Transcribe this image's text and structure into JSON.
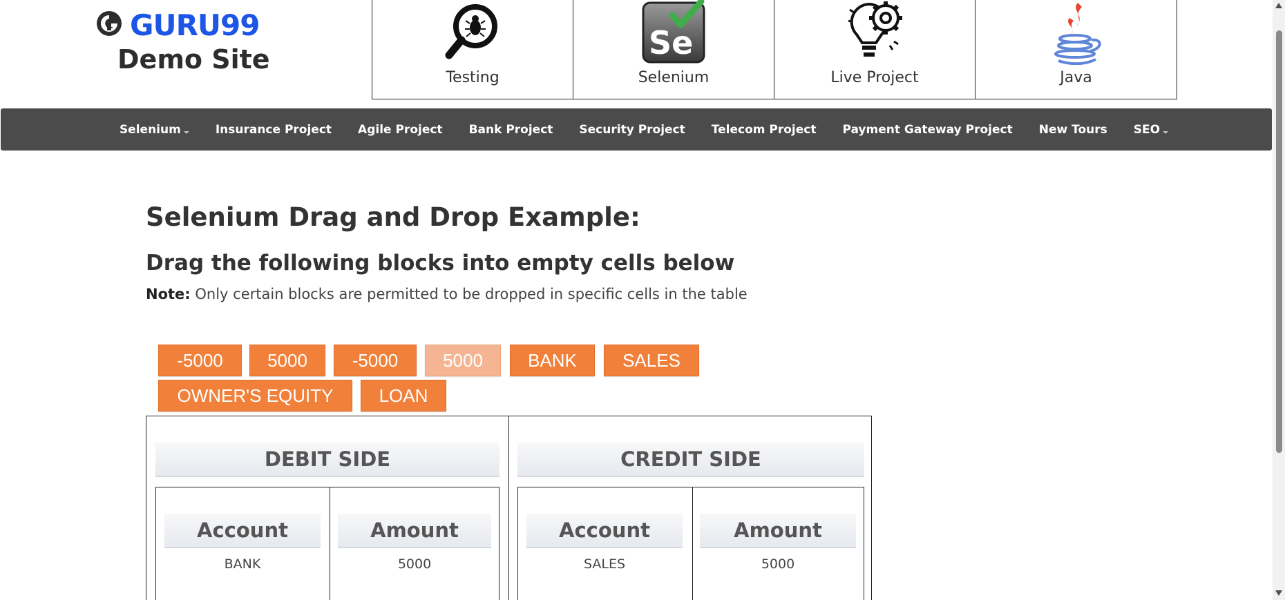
{
  "logo": {
    "brand": "GURU99",
    "subtitle": "Demo Site"
  },
  "top_boxes": [
    {
      "label": "Testing",
      "icon": "magnifier-bug-icon"
    },
    {
      "label": "Selenium",
      "icon": "selenium-logo-icon"
    },
    {
      "label": "Live Project",
      "icon": "lightbulb-gear-icon"
    },
    {
      "label": "Java",
      "icon": "java-logo-icon"
    }
  ],
  "nav": {
    "items": [
      {
        "label": "Selenium"
      },
      {
        "label": "Insurance Project"
      },
      {
        "label": "Agile Project"
      },
      {
        "label": "Bank Project"
      },
      {
        "label": "Security Project"
      },
      {
        "label": "Telecom Project"
      },
      {
        "label": "Payment Gateway Project"
      },
      {
        "label": "New Tours"
      },
      {
        "label": "SEO"
      }
    ]
  },
  "main": {
    "title": "Selenium Drag and Drop Example:",
    "subtitle": "Drag the following blocks into empty cells below",
    "note_label": "Note:",
    "note_text": "Only certain blocks are permitted to be dropped in specific cells in the table"
  },
  "blocks": [
    "-5000",
    "5000",
    "-5000",
    "5000",
    "BANK",
    "SALES",
    "OWNER'S EQUITY",
    "LOAN"
  ],
  "table": {
    "debit": {
      "title": "DEBIT SIDE",
      "account_header": "Account",
      "amount_header": "Amount",
      "account_value": "BANK",
      "amount_value": "5000"
    },
    "credit": {
      "title": "CREDIT SIDE",
      "account_header": "Account",
      "amount_header": "Amount",
      "account_value": "SALES",
      "amount_value": "5000"
    }
  },
  "colors": {
    "brand_blue": "#1d55e6",
    "nav_bg": "#4b4b4b",
    "block_orange": "#f1803a",
    "block_faded": "#f5b592"
  }
}
